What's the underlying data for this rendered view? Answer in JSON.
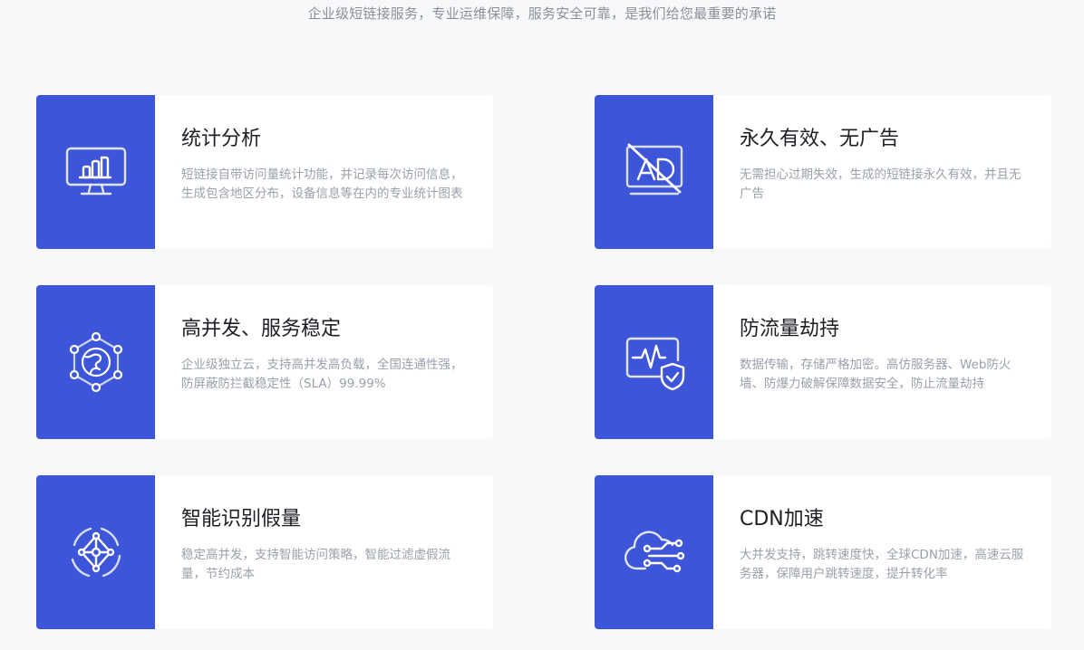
{
  "subtitle": "企业级短链接服务，专业运维保障，服务安全可靠，是我们给您最重要的承诺",
  "features": [
    {
      "title": "统计分析",
      "desc": "短链接自带访问量统计功能，并记录每次访问信息，生成包含地区分布，设备信息等在内的专业统计图表",
      "icon": "monitor-chart-icon"
    },
    {
      "title": "永久有效、无广告",
      "desc": "无需担心过期失效，生成的短链接永久有效，并且无广告",
      "icon": "no-ads-icon"
    },
    {
      "title": "高并发、服务稳定",
      "desc": "企业级独立云，支持高并发高负载，全国连通性强，防屏蔽防拦截稳定性（SLA）99.99%",
      "icon": "network-globe-icon"
    },
    {
      "title": "防流量劫持",
      "desc": "数据传输，存储严格加密。高仿服务器、Web防火墙、防爆力破解保障数据安全，防止流量劫持",
      "icon": "shield-pulse-icon"
    },
    {
      "title": "智能识别假量",
      "desc": "稳定高并发，支持智能访问策略，智能过滤虚假流量，节约成本",
      "icon": "smart-network-icon"
    },
    {
      "title": "CDN加速",
      "desc": "大并发支持，跳转速度快，全球CDN加速，高速云服务器，保障用户跳转速度，提升转化率",
      "icon": "cloud-cdn-icon"
    }
  ],
  "colors": {
    "accent": "#3d55d9",
    "background": "#f7f8fa",
    "card": "#ffffff"
  }
}
